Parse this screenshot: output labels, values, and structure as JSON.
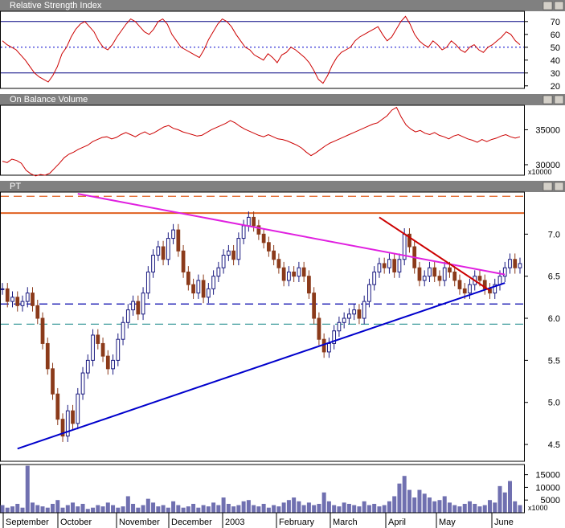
{
  "panels": {
    "rsi": {
      "title": "Relative Strength Index"
    },
    "obv": {
      "title": "On Balance Volume",
      "scale_note": "x10000"
    },
    "price": {
      "title": "PT"
    },
    "volume": {
      "scale_note": "x1000"
    }
  },
  "colors": {
    "title_bar": "#808080",
    "panel_border": "#000000",
    "line_red": "#cc0000",
    "candle_up": "#1a1a80",
    "candle_down": "#8b3a1a",
    "magenta_trend": "#e020e0",
    "blue_trend": "#0000cc",
    "orange_line": "#e06020",
    "blue_dashed": "#0000aa",
    "teal_dashed": "#3a9a9a",
    "volume_bar": "#7070b0"
  },
  "chart_data": [
    {
      "type": "line",
      "name": "rsi",
      "title": "Relative Strength Index",
      "ylim": [
        18,
        78
      ],
      "yticks": [
        20,
        30,
        40,
        50,
        60,
        70
      ],
      "reference_lines": [
        {
          "value": 70,
          "style": "solid"
        },
        {
          "value": 50,
          "style": "dotted"
        },
        {
          "value": 30,
          "style": "solid"
        }
      ],
      "values": [
        55,
        52,
        50,
        48,
        44,
        40,
        35,
        30,
        27,
        25,
        23,
        28,
        35,
        45,
        50,
        58,
        64,
        68,
        70,
        66,
        62,
        55,
        50,
        48,
        52,
        58,
        63,
        68,
        72,
        70,
        66,
        62,
        60,
        64,
        70,
        72,
        68,
        60,
        55,
        50,
        48,
        46,
        44,
        42,
        48,
        56,
        62,
        68,
        72,
        70,
        66,
        60,
        55,
        50,
        48,
        44,
        42,
        40,
        45,
        42,
        38,
        44,
        46,
        50,
        48,
        45,
        42,
        38,
        32,
        25,
        22,
        28,
        36,
        42,
        46,
        48,
        50,
        55,
        58,
        60,
        62,
        64,
        66,
        60,
        55,
        58,
        64,
        70,
        74,
        68,
        60,
        55,
        52,
        50,
        55,
        52,
        48,
        50,
        55,
        52,
        48,
        46,
        50,
        52,
        48,
        46,
        50,
        52,
        55,
        58,
        62,
        60,
        55,
        52
      ]
    },
    {
      "type": "line",
      "name": "obv",
      "title": "On Balance Volume",
      "ylim": [
        28500,
        38500
      ],
      "yticks": [
        30000,
        35000
      ],
      "values": [
        30500,
        30300,
        30800,
        30600,
        30200,
        29200,
        28700,
        28400,
        28600,
        28500,
        28800,
        29500,
        30200,
        31000,
        31500,
        31800,
        32200,
        32500,
        32800,
        33300,
        33600,
        33900,
        34000,
        33700,
        33900,
        34300,
        34600,
        34300,
        34000,
        34400,
        34700,
        34300,
        34600,
        35000,
        35400,
        35600,
        35200,
        35000,
        34700,
        34500,
        34300,
        34100,
        34200,
        34600,
        35000,
        35300,
        35600,
        35900,
        36300,
        36000,
        35500,
        35100,
        34800,
        34500,
        34200,
        34000,
        34300,
        34000,
        33700,
        33600,
        33400,
        33100,
        32800,
        32400,
        31800,
        31300,
        31700,
        32200,
        32700,
        33100,
        33400,
        33700,
        34000,
        34300,
        34600,
        34900,
        35200,
        35500,
        35800,
        36000,
        36500,
        37000,
        37800,
        38200,
        36800,
        35700,
        35100,
        34700,
        34900,
        34500,
        34300,
        34600,
        34200,
        34000,
        33700,
        34100,
        34300,
        34000,
        33700,
        33500,
        33200,
        33600,
        33300,
        33600,
        33800,
        34100,
        34300,
        34000,
        33800,
        34000
      ]
    },
    {
      "type": "bar",
      "name": "price",
      "title": "PT",
      "ylim": [
        4.3,
        7.5
      ],
      "yticks": [
        4.5,
        5.0,
        5.5,
        6.0,
        6.5,
        7.0
      ],
      "candles": [
        6.35,
        6.2,
        6.25,
        6.15,
        6.2,
        6.3,
        6.15,
        6.0,
        5.7,
        5.4,
        5.1,
        4.8,
        4.6,
        4.9,
        4.75,
        5.1,
        5.35,
        5.5,
        5.8,
        5.7,
        5.55,
        5.4,
        5.5,
        5.75,
        5.95,
        6.1,
        6.2,
        6.05,
        6.3,
        6.55,
        6.75,
        6.85,
        6.7,
        6.95,
        7.05,
        6.8,
        6.55,
        6.4,
        6.3,
        6.45,
        6.25,
        6.35,
        6.5,
        6.6,
        6.75,
        6.8,
        6.7,
        6.95,
        7.1,
        7.2,
        7.1,
        7.0,
        6.9,
        6.8,
        6.7,
        6.6,
        6.45,
        6.55,
        6.5,
        6.6,
        6.5,
        6.3,
        6.0,
        5.75,
        5.6,
        5.7,
        5.85,
        5.95,
        6.0,
        6.05,
        6.1,
        6.0,
        6.2,
        6.4,
        6.55,
        6.65,
        6.6,
        6.7,
        6.55,
        6.7,
        7.0,
        6.85,
        6.6,
        6.45,
        6.5,
        6.6,
        6.5,
        6.45,
        6.6,
        6.55,
        6.45,
        6.35,
        6.3,
        6.4,
        6.5,
        6.45,
        6.35,
        6.3,
        6.4,
        6.5,
        6.6,
        6.7,
        6.6,
        6.65
      ],
      "lines": [
        {
          "style": "dashed",
          "color_key": "orange_line",
          "value": 7.45
        },
        {
          "style": "solid",
          "color_key": "orange_line",
          "value": 7.25
        },
        {
          "style": "dashed",
          "color_key": "blue_dashed",
          "value": 6.17
        },
        {
          "style": "dashed",
          "color_key": "teal_dashed",
          "value": 5.93
        }
      ],
      "trendlines": [
        {
          "color_key": "magenta_trend",
          "from": [
            15,
            7.48
          ],
          "to": [
            100,
            6.52
          ]
        },
        {
          "color_key": "blue_trend",
          "from": [
            3,
            4.45
          ],
          "to": [
            100,
            6.42
          ]
        },
        {
          "color_key": "line_red",
          "from": [
            75,
            7.2
          ],
          "to": [
            97,
            6.33
          ]
        }
      ]
    },
    {
      "type": "bar",
      "name": "volume",
      "ylim": [
        0,
        19000
      ],
      "yticks": [
        5000,
        10000,
        15000
      ],
      "values": [
        3000,
        2000,
        2500,
        3500,
        2000,
        18500,
        4000,
        3000,
        2500,
        2000,
        3500,
        5000,
        2000,
        3000,
        4000,
        2500,
        3500,
        1500,
        2000,
        3000,
        2500,
        4000,
        3000,
        2000,
        2500,
        6500,
        3500,
        2000,
        3000,
        5500,
        4000,
        2500,
        3000,
        2000,
        4500,
        3000,
        2000,
        2500,
        3500,
        2000,
        3000,
        2500,
        4000,
        3000,
        6000,
        3500,
        2500,
        3000,
        4500,
        5000,
        3000,
        2500,
        3500,
        2000,
        3000,
        2500,
        4000,
        5000,
        6000,
        4500,
        3000,
        4000,
        3000,
        3500,
        8000,
        4500,
        3000,
        2500,
        4000,
        3500,
        3000,
        2500,
        4500,
        3000,
        3500,
        2500,
        3000,
        4500,
        6500,
        11500,
        14500,
        9000,
        6000,
        9000,
        7500,
        6000,
        4500,
        5000,
        6500,
        4000,
        3000,
        2500,
        3500,
        4500,
        3500,
        2500,
        3000,
        5000,
        4000,
        10500,
        8000,
        12500,
        4500,
        3000
      ],
      "xticks": [
        "September",
        "October",
        "November",
        "December",
        "2003",
        "February",
        "March",
        "April",
        "May",
        "June"
      ]
    }
  ]
}
